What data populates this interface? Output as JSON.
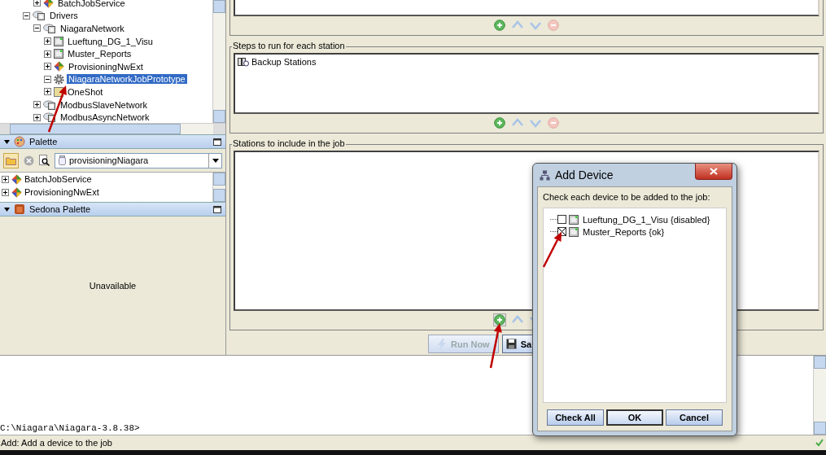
{
  "nav_tree": {
    "items": [
      {
        "children": [
          {
            "label": "BatchJobService",
            "kind": "service",
            "expanded": false,
            "selected": false
          }
        ]
      },
      {
        "label": "Drivers",
        "kind": "network",
        "expanded": true,
        "selected": false,
        "children": [
          {
            "label": "NiagaraNetwork",
            "kind": "network",
            "expanded": true,
            "selected": false,
            "children": [
              {
                "label": "Lueftung_DG_1_Visu",
                "kind": "station",
                "expanded": false,
                "selected": false
              },
              {
                "label": "Muster_Reports",
                "kind": "station",
                "expanded": false,
                "selected": false
              },
              {
                "label": "ProvisioningNwExt",
                "kind": "service",
                "expanded": false,
                "selected": false
              },
              {
                "label": "NiagaraNetworkJobPrototype",
                "kind": "job",
                "expanded": true,
                "selected": true
              },
              {
                "label": "OneShot",
                "kind": "square",
                "expanded": false,
                "selected": false
              }
            ]
          },
          {
            "label": "ModbusSlaveNetwork",
            "kind": "network",
            "expanded": false,
            "selected": false
          },
          {
            "label": "ModbusAsyncNetwork",
            "kind": "network",
            "expanded": false,
            "selected": false
          }
        ]
      }
    ]
  },
  "palette": {
    "title": "Palette",
    "search": {
      "value": "provisioningNiagara"
    },
    "items": [
      {
        "label": "BatchJobService",
        "kind": "service",
        "expanded": false
      },
      {
        "label": "ProvisioningNwExt",
        "kind": "service",
        "expanded": false
      }
    ]
  },
  "sedona_palette": {
    "title": "Sedona Palette",
    "message": "Unavailable"
  },
  "sections": [
    {
      "title": "Steps to run for each station",
      "items": [
        "Backup Stations"
      ]
    },
    {
      "title": "Stations to include in the job"
    }
  ],
  "buttons": [
    {
      "label": "Run Now",
      "kind": "run",
      "disabled": true
    },
    {
      "label": "Sa",
      "kind": "save",
      "disabled": false
    }
  ],
  "console": {
    "prompt": "C:\\Niagara\\Niagara-3.8.38>"
  },
  "status_bar": {
    "text": "Add: Add a device to the job"
  },
  "dialog": {
    "title": "Add Device",
    "instruction": "Check each device to be added to the job:",
    "devices": [
      {
        "label": "Lueftung_DG_1_Visu {disabled}",
        "checked": false
      },
      {
        "label": "Muster_Reports {ok}",
        "checked": true
      }
    ],
    "buttons": [
      {
        "label": "Check All",
        "default": false
      },
      {
        "label": "OK",
        "default": true
      },
      {
        "label": "Cancel",
        "default": false
      }
    ]
  }
}
